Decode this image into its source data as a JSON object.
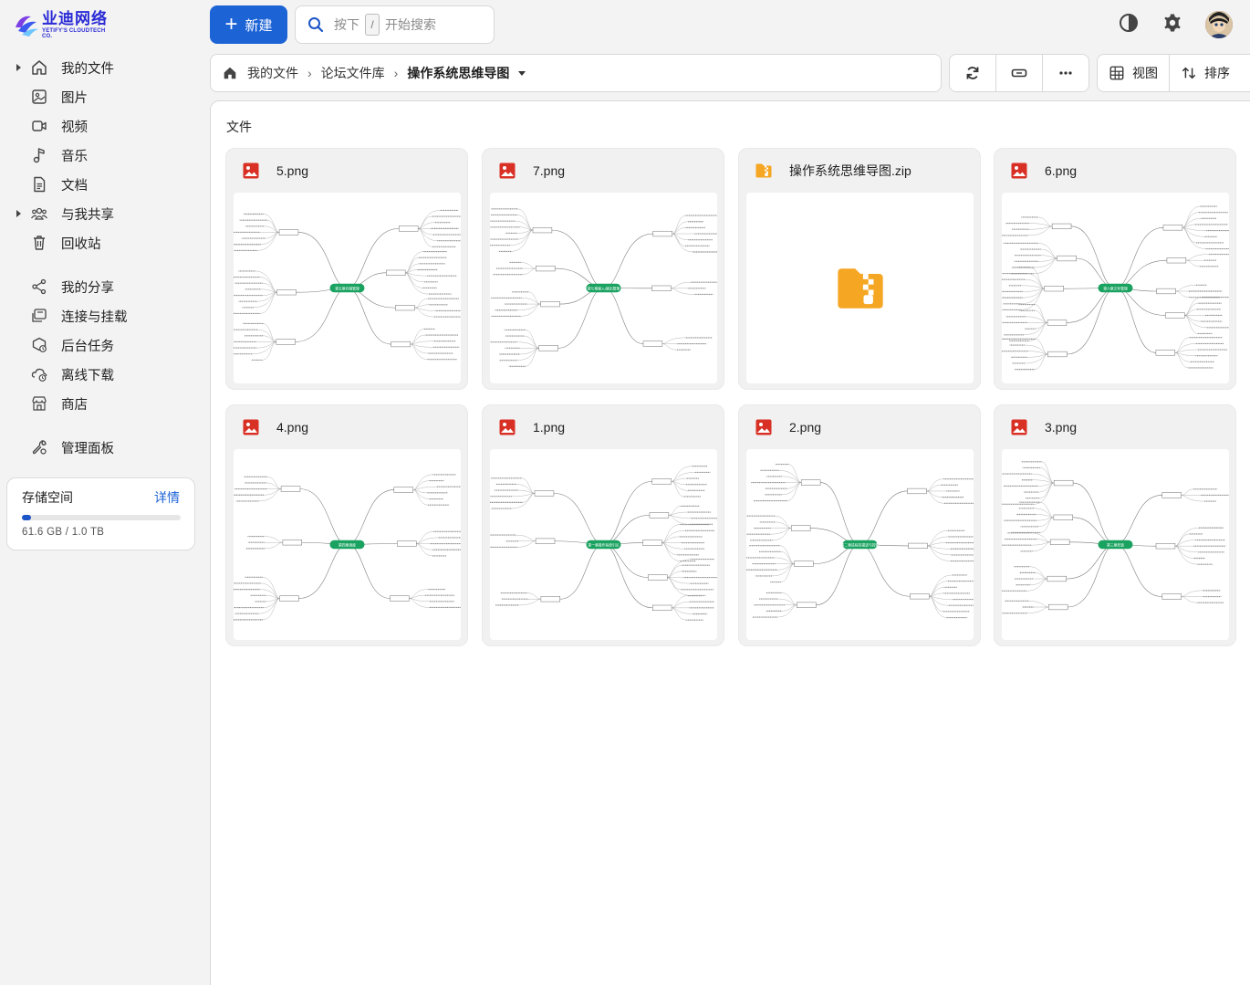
{
  "brand": {
    "name": "业迪网络",
    "subtitle": "YETIFY'S CLOUDTECH CO.",
    "color": "#2a2ad6"
  },
  "sidebar": {
    "items": [
      {
        "label": "我的文件",
        "icon": "home-icon",
        "expandable": true
      },
      {
        "label": "图片",
        "icon": "image-icon",
        "expandable": false
      },
      {
        "label": "视频",
        "icon": "video-icon",
        "expandable": false
      },
      {
        "label": "音乐",
        "icon": "music-icon",
        "expandable": false
      },
      {
        "label": "文档",
        "icon": "document-icon",
        "expandable": false
      },
      {
        "label": "与我共享",
        "icon": "people-icon",
        "expandable": true
      },
      {
        "label": "回收站",
        "icon": "trash-icon",
        "expandable": false
      },
      {
        "label": "我的分享",
        "icon": "share-icon",
        "expandable": false
      },
      {
        "label": "连接与挂载",
        "icon": "connect-icon",
        "expandable": false
      },
      {
        "label": "后台任务",
        "icon": "tasks-icon",
        "expandable": false
      },
      {
        "label": "离线下载",
        "icon": "cloud-download-icon",
        "expandable": false
      },
      {
        "label": "商店",
        "icon": "store-icon",
        "expandable": false
      },
      {
        "label": "管理面板",
        "icon": "wrench-icon",
        "expandable": false
      }
    ]
  },
  "storage": {
    "title": "存储空间",
    "details_link": "详情",
    "usage_text": "61.6 GB / 1.0 TB",
    "used_fraction": 0.06
  },
  "toolbar": {
    "new_button": "新建",
    "search_prefix": "按下",
    "search_key": "/",
    "search_suffix": "开始搜索"
  },
  "breadcrumb": {
    "items": [
      "我的文件",
      "论坛文件库"
    ],
    "current": "操作系统思维导图"
  },
  "view_controls": {
    "view_label": "视图",
    "sort_label": "排序"
  },
  "main": {
    "section_title": "文件",
    "files": [
      {
        "name": "5.png",
        "type": "image",
        "center_label": "第五章存储管理"
      },
      {
        "name": "7.png",
        "type": "image",
        "center_label": "第七章输入/输出管理"
      },
      {
        "name": "操作系统思维导图.zip",
        "type": "archive",
        "center_label": ""
      },
      {
        "name": "6.png",
        "type": "image",
        "center_label": "第六章文件管理"
      },
      {
        "name": "4.png",
        "type": "image",
        "center_label": "第四章调度"
      },
      {
        "name": "1.png",
        "type": "image",
        "center_label": "第一章操作系统引论"
      },
      {
        "name": "2.png",
        "type": "image",
        "center_label": "第二章进程的描述与控制"
      },
      {
        "name": "3.png",
        "type": "image",
        "center_label": "第三章死锁"
      }
    ]
  },
  "colors": {
    "accent": "#1c63d6",
    "image_icon": "#d93025",
    "archive_icon": "#f5a623",
    "mindmap_green": "#1aa260"
  }
}
